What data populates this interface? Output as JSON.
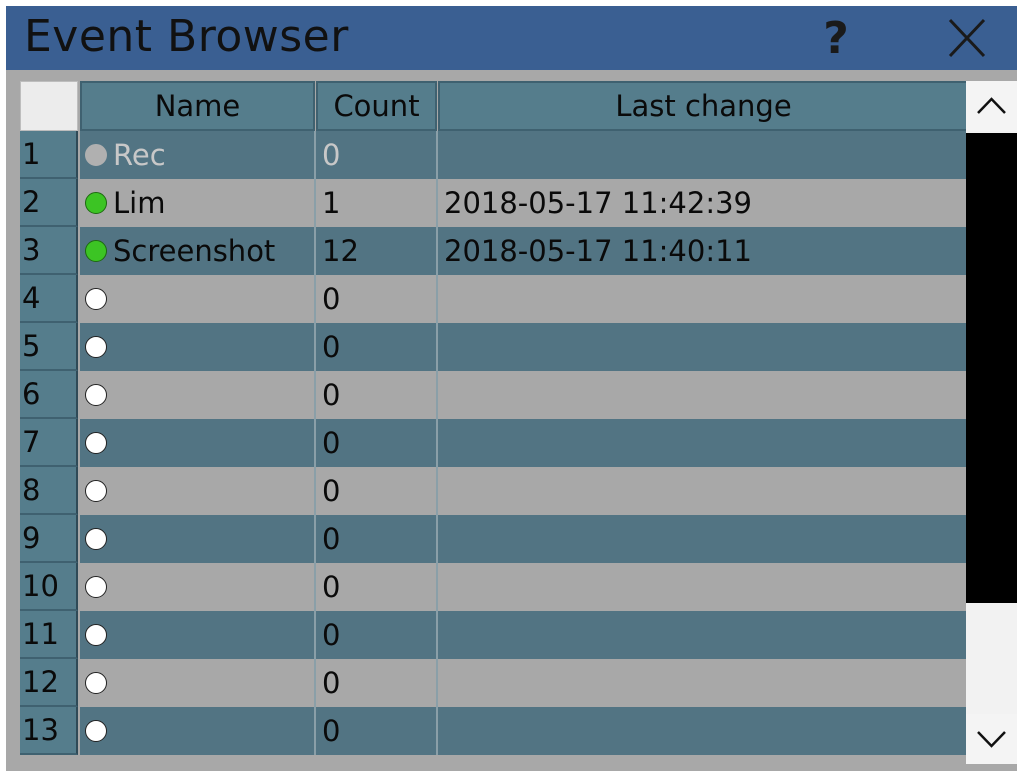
{
  "window": {
    "title": "Event Browser",
    "help_label": "?"
  },
  "columns": [
    "Name",
    "Count",
    "Last change"
  ],
  "rows": [
    {
      "num": "1",
      "status": "gray",
      "name": "Rec",
      "count": "0",
      "last_change": ""
    },
    {
      "num": "2",
      "status": "green",
      "name": "Lim",
      "count": "1",
      "last_change": "2018-05-17 11:42:39"
    },
    {
      "num": "3",
      "status": "green",
      "name": "Screenshot",
      "count": "12",
      "last_change": "2018-05-17 11:40:11"
    },
    {
      "num": "4",
      "status": "white",
      "name": "",
      "count": "0",
      "last_change": ""
    },
    {
      "num": "5",
      "status": "white",
      "name": "",
      "count": "0",
      "last_change": ""
    },
    {
      "num": "6",
      "status": "white",
      "name": "",
      "count": "0",
      "last_change": ""
    },
    {
      "num": "7",
      "status": "white",
      "name": "",
      "count": "0",
      "last_change": ""
    },
    {
      "num": "8",
      "status": "white",
      "name": "",
      "count": "0",
      "last_change": ""
    },
    {
      "num": "9",
      "status": "white",
      "name": "",
      "count": "0",
      "last_change": ""
    },
    {
      "num": "10",
      "status": "white",
      "name": "",
      "count": "0",
      "last_change": ""
    },
    {
      "num": "11",
      "status": "white",
      "name": "",
      "count": "0",
      "last_change": ""
    },
    {
      "num": "12",
      "status": "white",
      "name": "",
      "count": "0",
      "last_change": ""
    },
    {
      "num": "13",
      "status": "white",
      "name": "",
      "count": "0",
      "last_change": ""
    }
  ],
  "icons": {
    "close": "close-icon",
    "scroll_up": "chevron-up-icon",
    "scroll_down": "chevron-down-icon",
    "status": "status-dot-icon"
  },
  "colors": {
    "titlebar": "#3a5f92",
    "row_dark": "#527483",
    "row_light": "#a8a8a8",
    "status_green": "#3cc424",
    "status_gray": "#b0b0b0",
    "status_white": "#ffffff"
  }
}
